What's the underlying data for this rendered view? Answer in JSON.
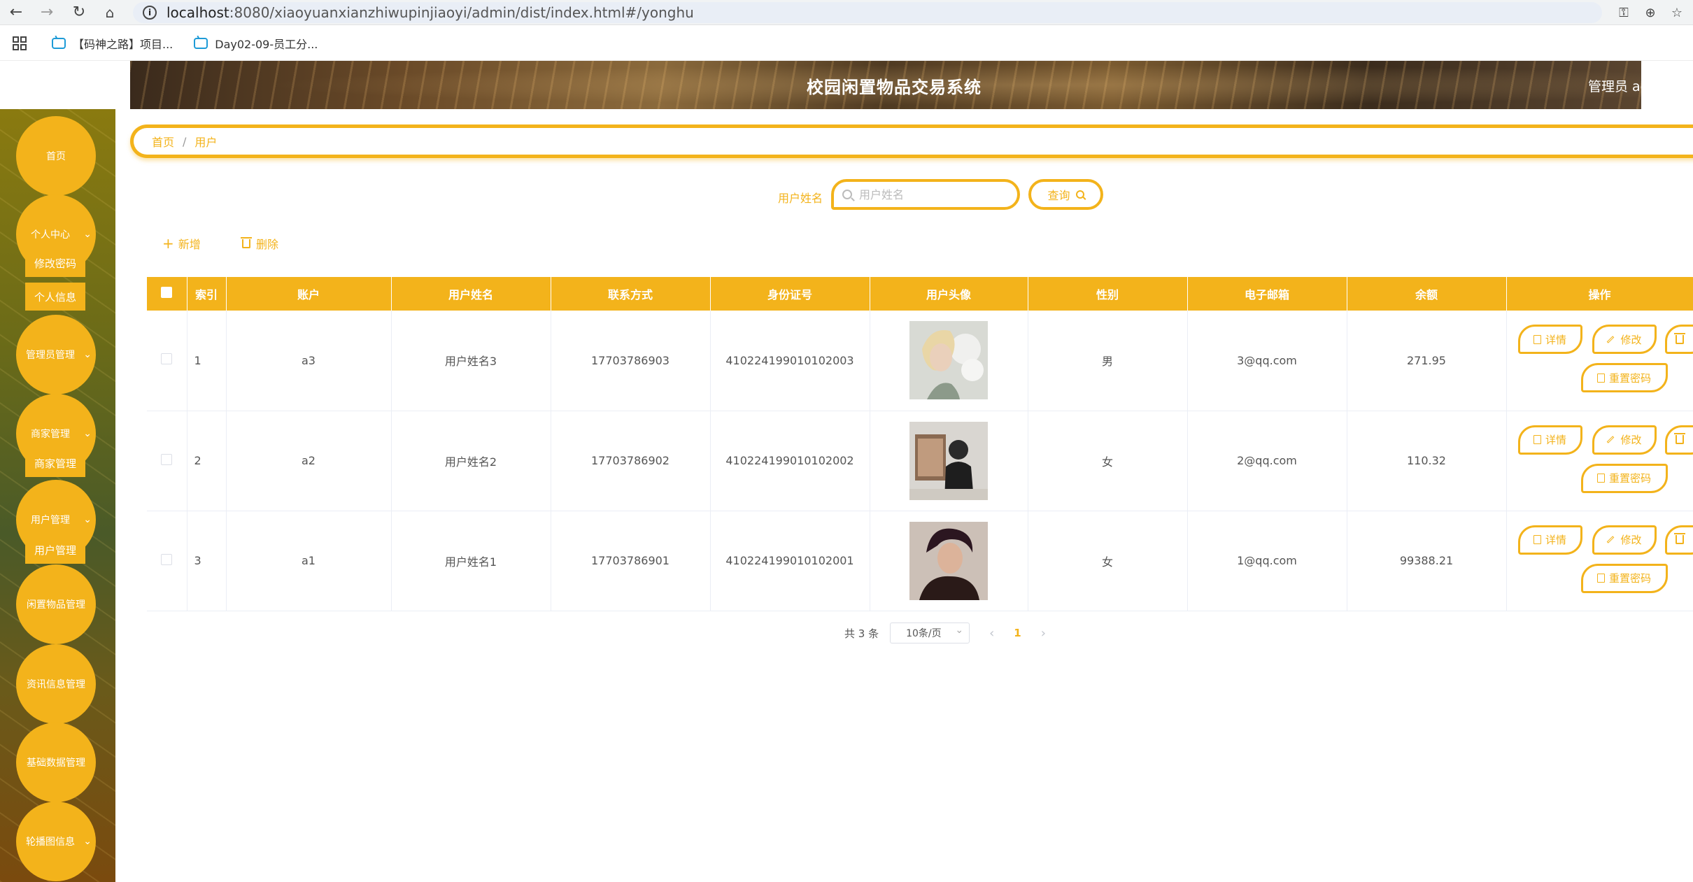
{
  "browser": {
    "url_host": "localhost",
    "url_path": ":8080/xiaoyuanxianzhiwupinjiaoyi/admin/dist/index.html#/yonghu",
    "bookmarks": [
      "【码神之路】项目...",
      "Day02-09-员工分..."
    ]
  },
  "header": {
    "title": "校园闲置物品交易系统",
    "user": "管理员 ad"
  },
  "sidebar": {
    "items": [
      {
        "label": "首页",
        "chevron": false
      },
      {
        "label": "个人中心",
        "chevron": true
      },
      {
        "label": "管理员管理",
        "chevron": true
      },
      {
        "label": "商家管理",
        "chevron": true
      },
      {
        "label": "用户管理",
        "chevron": true
      },
      {
        "label": "闲置物品管理",
        "chevron": false
      },
      {
        "label": "资讯信息管理",
        "chevron": false
      },
      {
        "label": "基础数据管理",
        "chevron": false
      },
      {
        "label": "轮播图信息",
        "chevron": true
      }
    ],
    "subitems": [
      "修改密码",
      "个人信息",
      "商家管理",
      "用户管理"
    ]
  },
  "breadcrumb": {
    "home": "首页",
    "separator": "/",
    "current": "用户"
  },
  "search": {
    "label": "用户姓名",
    "placeholder": "用户姓名",
    "button": "查询"
  },
  "toolbar": {
    "add": "新增",
    "delete": "删除"
  },
  "table": {
    "headers": [
      "索引",
      "账户",
      "用户姓名",
      "联系方式",
      "身份证号",
      "用户头像",
      "性别",
      "电子邮箱",
      "余额",
      "操作"
    ],
    "rows": [
      {
        "index": "1",
        "account": "a3",
        "name": "用户姓名3",
        "phone": "17703786903",
        "id_card": "410224199010102003",
        "gender": "男",
        "email": "3@qq.com",
        "balance": "271.95"
      },
      {
        "index": "2",
        "account": "a2",
        "name": "用户姓名2",
        "phone": "17703786902",
        "id_card": "410224199010102002",
        "gender": "女",
        "email": "2@qq.com",
        "balance": "110.32"
      },
      {
        "index": "3",
        "account": "a1",
        "name": "用户姓名1",
        "phone": "17703786901",
        "id_card": "410224199010102001",
        "gender": "女",
        "email": "1@qq.com",
        "balance": "99388.21"
      }
    ],
    "actions": {
      "detail": "详情",
      "edit": "修改",
      "reset": "重置密码"
    }
  },
  "pagination": {
    "total": "共 3 条",
    "page_size": "10条/页",
    "current": "1"
  },
  "colors": {
    "accent": "#f3b31b"
  }
}
